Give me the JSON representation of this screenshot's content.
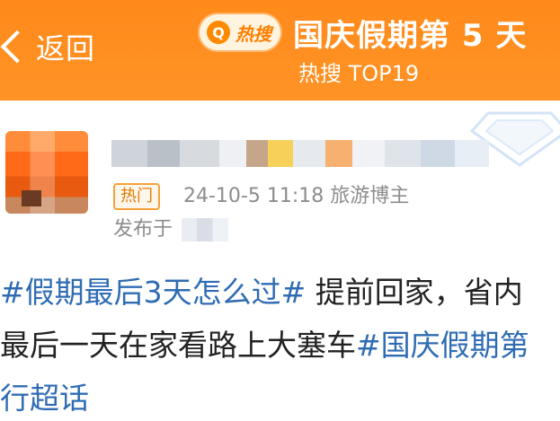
{
  "header": {
    "back_label": "返回",
    "hot_badge": "热搜",
    "hot_badge_icon": "Q",
    "topic_title": "国庆假期第 5 天",
    "topic_sub": "热搜 TOP19",
    "bg_color": "#ff8a1a"
  },
  "post": {
    "hot_tag": "热门",
    "meta": "24-10-5 11:18  旅游博主",
    "posted_prefix": "发布于",
    "lines": [
      {
        "tag": "#假期最后3天怎么过#",
        "text": " 提前回家，省内"
      },
      {
        "text": "最后一天在家看路上大塞车",
        "tag": "#国庆假期第"
      },
      {
        "text": "行超话"
      }
    ],
    "tag_color": "#2f6cb3"
  }
}
